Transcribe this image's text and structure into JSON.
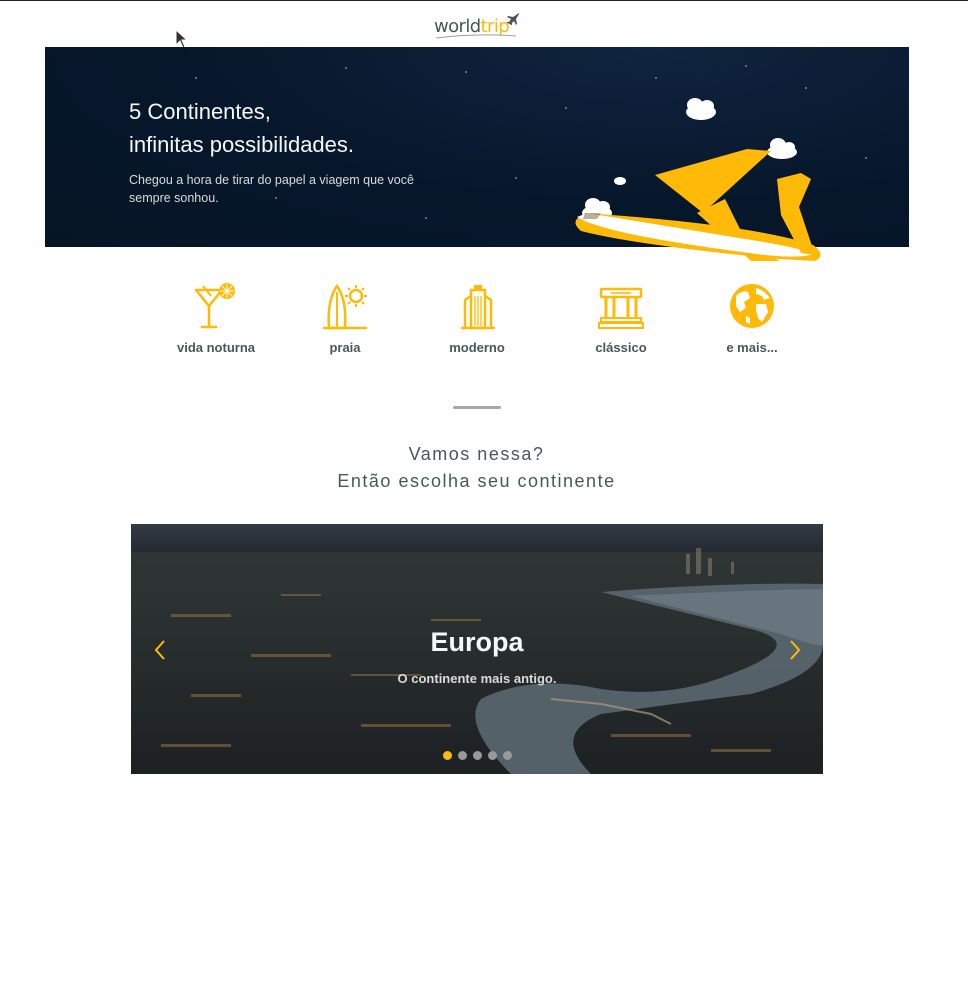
{
  "header": {
    "logo": {
      "word_main": "world",
      "word_accent": "trip",
      "icon": "airplane-icon"
    }
  },
  "banner": {
    "title_line1": "5 Continentes,",
    "title_line2": "infinitas possibilidades.",
    "subtitle": "Chegou a hora de tirar do papel a viagem que você sempre sonhou.",
    "illustration": "airplane-with-clouds"
  },
  "travel_types": [
    {
      "label": "vida noturna",
      "icon": "cocktail-icon"
    },
    {
      "label": "praia",
      "icon": "surfboard-sun-icon"
    },
    {
      "label": "moderno",
      "icon": "skyscraper-icon"
    },
    {
      "label": "clássico",
      "icon": "museum-icon"
    },
    {
      "label": "e mais...",
      "icon": "globe-icon"
    }
  ],
  "section": {
    "heading_line1": "Vamos nessa?",
    "heading_line2": "Então escolha seu continente"
  },
  "slider": {
    "active_index": 0,
    "slide_count": 5,
    "current": {
      "title": "Europa",
      "subtitle": "O continente mais antigo."
    },
    "prev_icon": "chevron-left-icon",
    "next_icon": "chevron-right-icon"
  },
  "colors": {
    "accent": "#FFBA08",
    "text_dark": "#47585B",
    "text_light": "#F5F8FA",
    "banner_bg": "#07172b",
    "dot_inactive": "#999999"
  }
}
